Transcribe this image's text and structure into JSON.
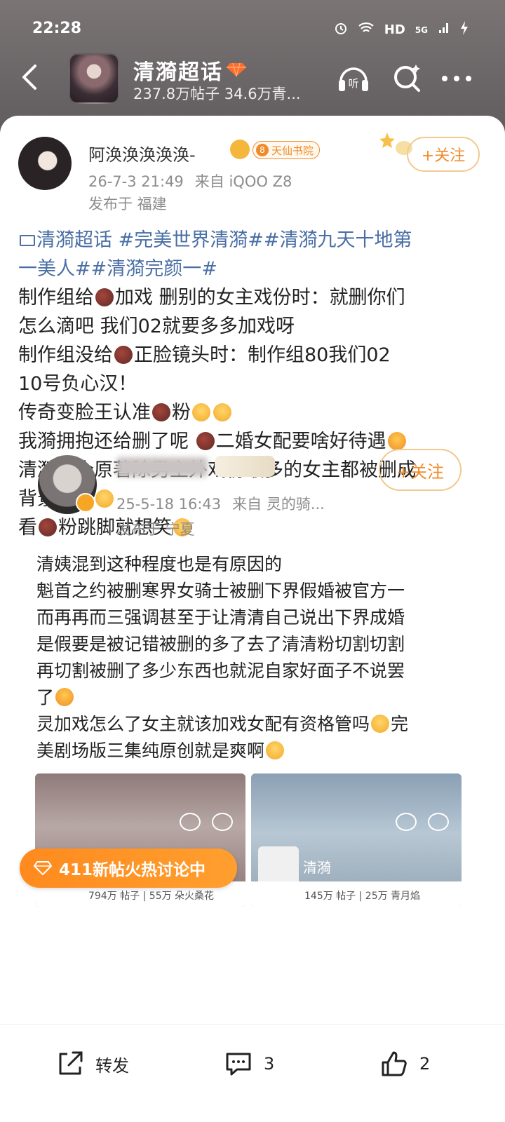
{
  "status_bar": {
    "time": "22:28",
    "network": "HD",
    "signal": "5G"
  },
  "header": {
    "title": "清漪超话",
    "subtitle": "237.8万帖子 34.6万青...",
    "listen_label": "听"
  },
  "post": {
    "author": "阿涣涣涣涣涣-",
    "badge_level": "8",
    "badge_text": "天仙书院",
    "date": "26-7-3 21:49",
    "source": "来自 iQOO Z8",
    "location": "发布于 福建",
    "follow_label": "+关注",
    "lines": [
      {
        "pre": "",
        "tag": "清漪超话 #完美世界清漪##清漪九天十地第",
        "post": ""
      },
      {
        "pre": "",
        "tag": "一美人##清漪完颜一#",
        "post": ""
      },
      {
        "pre": "制作组给",
        "mid": "加戏 删别的女主戏份时：就删你们",
        "end": ""
      },
      {
        "pre": "怎么滴吧 我们02就要多多加戏呀"
      },
      {
        "pre": "制作组没给",
        "mid": "正脸镜头时：制作组80我们02"
      },
      {
        "pre": "10号负心汉！"
      },
      {
        "pre": "传奇变脸王认准",
        "mid": "粉"
      },
      {
        "pre": "我漪拥抱还给删了呢 ",
        "mid": "二婚女配要啥好待遇"
      },
      {
        "pre": "清漪一个原著除男主外戏份最多的女主都被删成"
      },
      {
        "pre": "背景板了"
      },
      {
        "pre": "看",
        "mid": "粉跳脚就想笑"
      }
    ]
  },
  "quoted": {
    "date": "25-5-18 16:43",
    "source": "来自 灵的骑...",
    "location": "发布于 宁夏",
    "follow_label": "+关注",
    "lines": [
      "清姨混到这种程度也是有原因的",
      "魁首之约被删寒界女骑士被删下界假婚被官方一",
      "而再再而三强调甚至于让清清自己说出下界成婚",
      "是假要是被记错被删的多了去了清清粉切割切割",
      "再切割被删了多少东西也就泥自家好面子不说罢",
      "了",
      "灵加戏怎么了女主就该加戏女配有资格管吗",
      "美剧场版三集纯原创就是爽啊"
    ],
    "line7_end": "完",
    "thumb1": {
      "stats": "794万 帖子 | 55万 朵火桑花"
    },
    "thumb2": {
      "name": "清漪",
      "stats": "145万 帖子 | 25万 青月焰"
    }
  },
  "hot_pill": {
    "label": "411新帖火热讨论中"
  },
  "actions": {
    "share": "转发",
    "comment_count": "3",
    "like_count": "2"
  },
  "colors": {
    "accent": "#f08b2a",
    "tag_blue": "#4a6fa5",
    "hot_orange": "#ff8a1e"
  }
}
